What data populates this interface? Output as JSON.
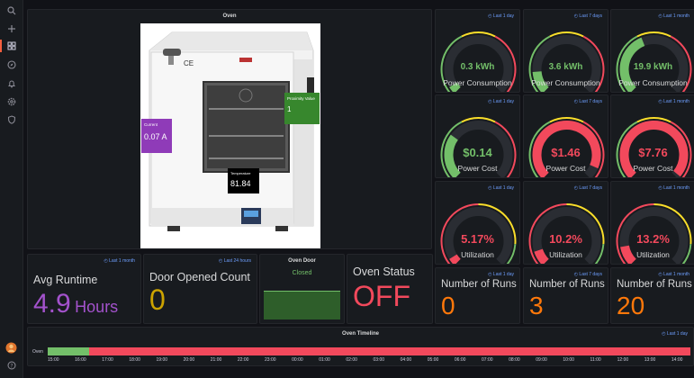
{
  "sidebar": {
    "icons": [
      "search-icon",
      "plus-icon",
      "dashboards-icon",
      "explore-icon",
      "alerting-icon",
      "configuration-icon",
      "shield-icon"
    ]
  },
  "oven_panel": {
    "title": "Oven",
    "current": {
      "label": "Current",
      "value": "0.07 A",
      "color": "#8f3bb8"
    },
    "proximity": {
      "label": "Proximity Value",
      "value": "1",
      "color": "#37872d"
    },
    "temperature": {
      "label": "Temperature",
      "value": "81.84"
    }
  },
  "gauges": [
    {
      "range": "Last 1 day",
      "value": "0.3 kWh",
      "label": "Power Consumption",
      "fraction": 0.05,
      "color": "#73bf69"
    },
    {
      "range": "Last 7 days",
      "value": "3.6 kWh",
      "label": "Power Consumption",
      "fraction": 0.15,
      "color": "#73bf69"
    },
    {
      "range": "Last 1 month",
      "value": "19.9 kWh",
      "label": "Power Consumption",
      "fraction": 0.42,
      "color": "#73bf69"
    },
    {
      "range": "Last 1 day",
      "value": "$0.14",
      "label": "Power Cost",
      "fraction": 0.3,
      "color": "#73bf69"
    },
    {
      "range": "Last 7 days",
      "value": "$1.46",
      "label": "Power Cost",
      "fraction": 0.92,
      "color": "#f2495c"
    },
    {
      "range": "Last 1 month",
      "value": "$7.76",
      "label": "Power Cost",
      "fraction": 0.98,
      "color": "#f2495c"
    },
    {
      "range": "Last 1 day",
      "value": "5.17%",
      "label": "Utilization",
      "fraction": 0.05,
      "color": "#f2495c"
    },
    {
      "range": "Last 7 days",
      "value": "10.2%",
      "label": "Utilization",
      "fraction": 0.1,
      "color": "#f2495c"
    },
    {
      "range": "Last 1 month",
      "value": "13.2%",
      "label": "Utilization",
      "fraction": 0.13,
      "color": "#f2495c"
    }
  ],
  "avg_runtime": {
    "range": "Last 1 month",
    "title": "Avg Runtime",
    "value": "4.9",
    "unit": "Hours",
    "color": "#a352cc"
  },
  "door_count": {
    "range": "Last 24 hours",
    "title": "Door Opened Count",
    "value": "0",
    "color": "#cca300"
  },
  "oven_door": {
    "title": "Oven Door",
    "value": "Closed",
    "color": "#73bf69"
  },
  "oven_status": {
    "title": "Oven Status",
    "value": "OFF",
    "color": "#f2495c"
  },
  "runs": [
    {
      "range": "Last 1 day",
      "title": "Number of Runs",
      "value": "0",
      "color": "#ff780a"
    },
    {
      "range": "Last 7 days",
      "title": "Number of Runs",
      "value": "3",
      "color": "#ff780a"
    },
    {
      "range": "Last 1 month",
      "title": "Number of Runs",
      "value": "20",
      "color": "#ff780a"
    }
  ],
  "timeline": {
    "title": "Oven Timeline",
    "range": "Last 1 day",
    "row_label": "Oven",
    "on_fraction": 0.065,
    "on_color": "#73bf69",
    "off_color": "#f2495c",
    "ticks": [
      "15:00",
      "16:00",
      "17:00",
      "18:00",
      "19:00",
      "20:00",
      "21:00",
      "22:00",
      "23:00",
      "00:00",
      "01:00",
      "02:00",
      "03:00",
      "04:00",
      "05:00",
      "06:00",
      "07:00",
      "08:00",
      "09:00",
      "10:00",
      "11:00",
      "12:00",
      "13:00",
      "14:00"
    ]
  },
  "user": {
    "help_icon": "help-icon",
    "avatar": "avatar"
  }
}
